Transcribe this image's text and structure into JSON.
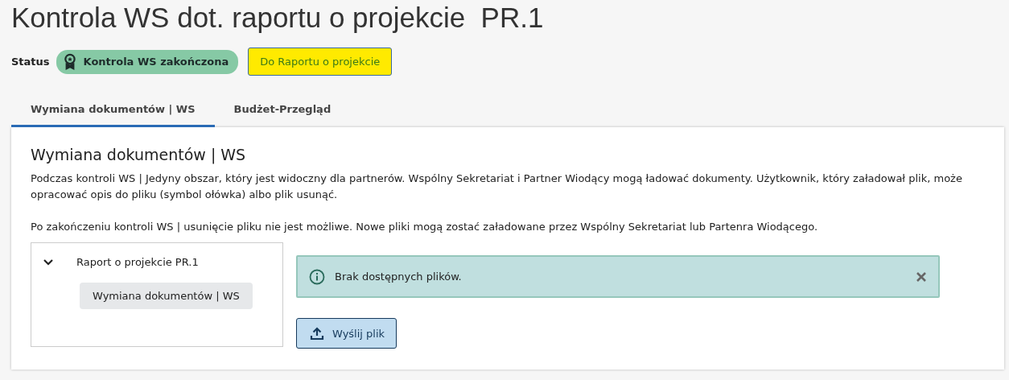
{
  "title": "Kontrola WS dot. raportu o projekcie  PR.1",
  "status": {
    "label": "Status",
    "badge": "Kontrola WS zakończona"
  },
  "report_button": "Do Raportu o projekcie",
  "tabs": [
    {
      "label": "Wymiana dokumentów | WS",
      "selected": true
    },
    {
      "label": "Budżet-Przegląd",
      "selected": false
    }
  ],
  "panel": {
    "heading": "Wymiana dokumentów | WS",
    "paragraphs": [
      "Podczas kontroli WS | Jedyny obszar, który jest widoczny dla partnerów. Wspólny Sekretariat i Partner Wiodący mogą ładować dokumenty. Użytkownik, który załadował plik, może opracować opis do pliku  (symbol ołówka) albo plik usunąć.",
      "Po zakończeniu kontroli WS | usunięcie pliku nie jest możliwe. Nowe pliki mogą zostać załadowane przez Wspólny Sekretariat lub Partenra Wiodącego."
    ],
    "tree": [
      {
        "label": "Raport o projekcie PR.1",
        "expanded": true,
        "children": [
          {
            "label": "Wymiana dokumentów | WS",
            "selected": true
          }
        ]
      }
    ],
    "alert": {
      "text": "Brak dostępnych plików."
    },
    "upload_button": "Wyślij plik"
  }
}
